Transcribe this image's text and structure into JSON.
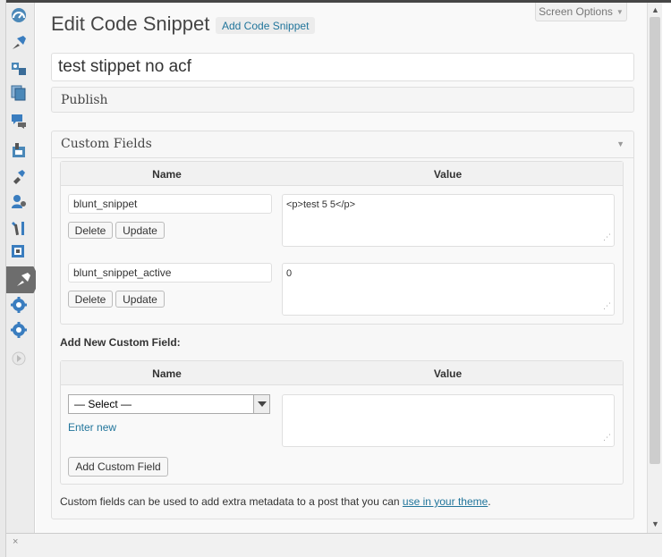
{
  "toolbar": {
    "screen_options": "Screen Options",
    "screen_options_arrow": "▼"
  },
  "page": {
    "title": "Edit Code Snippet",
    "add_new": "Add Code Snippet"
  },
  "post_title": {
    "value": "test stippet no acf"
  },
  "publish_box": {
    "title": "Publish"
  },
  "custom_fields": {
    "title": "Custom Fields",
    "columns": {
      "name": "Name",
      "value": "Value"
    },
    "rows": [
      {
        "key": "blunt_snippet",
        "value": "<p>test 5 5</p>",
        "delete_label": "Delete",
        "update_label": "Update"
      },
      {
        "key": "blunt_snippet_active",
        "value": "0",
        "delete_label": "Delete",
        "update_label": "Update"
      }
    ],
    "add_new": {
      "heading": "Add New Custom Field:",
      "columns": {
        "name": "Name",
        "value": "Value"
      },
      "select_value": "— Select —",
      "enter_new": "Enter new",
      "button": "Add Custom Field"
    },
    "help": {
      "text_before": "Custom fields can be used to add extra metadata to a post that you can ",
      "link": "use in your theme",
      "text_after": "."
    }
  },
  "admin_menu_icons": [
    "dashboard-icon",
    "posts-icon",
    "media-icon",
    "pages-icon",
    "comments-icon",
    "appearance-icon",
    "plugins-icon",
    "users-icon",
    "tools-icon",
    "settings-icon",
    "snippets-icon",
    "settings-2-icon",
    "settings-3-icon",
    "collapse-menu-icon"
  ],
  "colors": {
    "link": "#21759b",
    "active_menu": "#6d6d6d",
    "title_text": "#464646"
  },
  "footer": {
    "close_glyph": "×"
  }
}
